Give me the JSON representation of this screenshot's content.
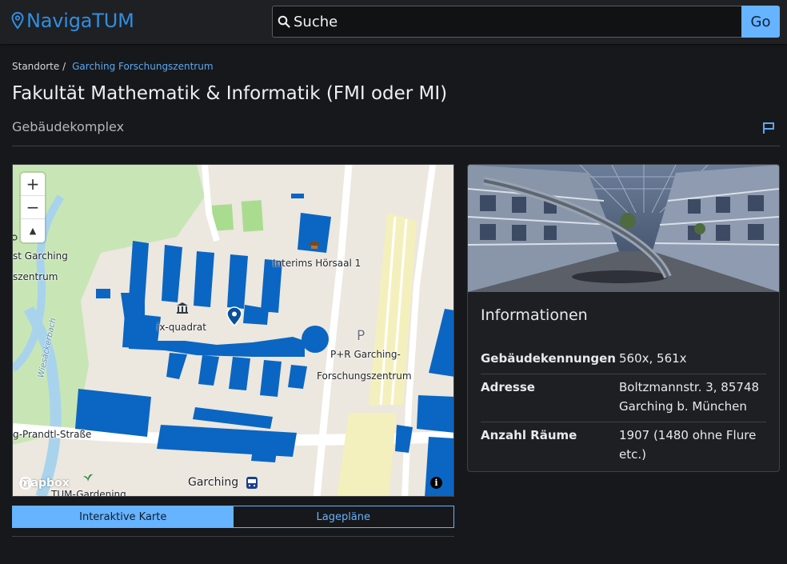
{
  "header": {
    "logo_text": "NavigaTUM",
    "search_placeholder": "Suche",
    "go_label": "Go"
  },
  "breadcrumb": {
    "root": "Standorte /",
    "current": "Garching Forschungszentrum"
  },
  "page": {
    "title": "Fakultät Mathematik & Informatik (FMI oder MI)",
    "subtitle": "Gebäudekomplex"
  },
  "map": {
    "zoom_in": "+",
    "zoom_out": "−",
    "compass": "▲",
    "attribution_logo": "mapbox",
    "info_icon": "i",
    "labels": {
      "garching_1": "st Garching",
      "garching_2": "szentrum",
      "hoersaal": "Interims Hörsaal 1",
      "ixquadrat": "ix-quadrat",
      "parking_letter": "P",
      "parking_1": "P+R Garching-",
      "parking_2": "Forschungszentrum",
      "street": "g-Prandtl-Straße",
      "creek": "Wiesäckerbach",
      "garching_station": "Garching",
      "gardening": "TUM-Gardening"
    }
  },
  "view_toggle": {
    "active": "Interaktive Karte",
    "inactive": "Lagepläne"
  },
  "info_card": {
    "title": "Informationen",
    "rows": [
      {
        "key": "Gebäudekennungen",
        "value": "560x, 561x"
      },
      {
        "key": "Adresse",
        "value": "Boltzmannstr. 3, 85748 Garching b. München"
      },
      {
        "key": "Anzahl Räume",
        "value": "1907 (1480 ohne Flure etc.)"
      }
    ]
  },
  "colors": {
    "accent": "#66b3ff",
    "logo": "#2f8fe0",
    "building": "#0a66c2",
    "background": "#17181b"
  }
}
